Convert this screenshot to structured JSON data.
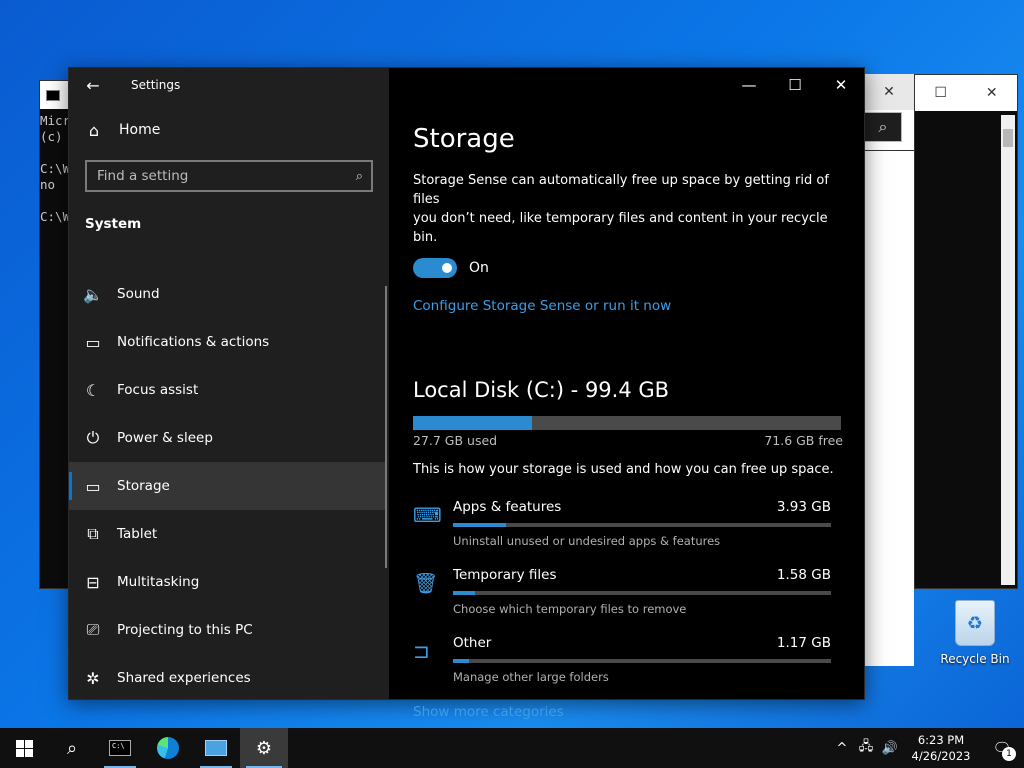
{
  "background_windows": {
    "cmd_text_lines": [
      "Micr",
      "(c)",
      "",
      "C:\\W",
      "no",
      "",
      "C:\\W"
    ],
    "explorer_search_icon": "search-icon",
    "cmd2_controls": [
      "—",
      "☐",
      "✕"
    ]
  },
  "settings": {
    "app_title": "Settings",
    "home_label": "Home",
    "search_placeholder": "Find a setting",
    "section_title": "System",
    "nav_items": [
      {
        "label": "Sound",
        "icon": "speaker-icon"
      },
      {
        "label": "Notifications & actions",
        "icon": "notification-icon"
      },
      {
        "label": "Focus assist",
        "icon": "moon-icon"
      },
      {
        "label": "Power & sleep",
        "icon": "power-icon"
      },
      {
        "label": "Storage",
        "icon": "storage-icon",
        "selected": true
      },
      {
        "label": "Tablet",
        "icon": "tablet-icon"
      },
      {
        "label": "Multitasking",
        "icon": "multitasking-icon"
      },
      {
        "label": "Projecting to this PC",
        "icon": "projector-icon"
      },
      {
        "label": "Shared experiences",
        "icon": "shared-experiences-icon"
      }
    ],
    "content": {
      "page_title": "Storage",
      "storage_sense_desc_line1": "Storage Sense can automatically free up space by getting rid of files",
      "storage_sense_desc_line2": "you don’t need, like temporary files and content in your recycle bin.",
      "toggle_label": "On",
      "configure_link": "Configure Storage Sense or run it now",
      "disk_title": "Local Disk (C:) - 99.4 GB",
      "disk_used_fraction": 0.279,
      "disk_used": "27.7 GB used",
      "disk_free": "71.6 GB free",
      "disk_note": "This is how your storage is used and how you can free up space.",
      "categories": [
        {
          "name": "Apps & features",
          "size": "3.93 GB",
          "desc": "Uninstall unused or undesired apps & features",
          "fraction": 0.14,
          "icon": "keyboard-icon"
        },
        {
          "name": "Temporary files",
          "size": "1.58 GB",
          "desc": "Choose which temporary files to remove",
          "fraction": 0.057,
          "icon": "trash-icon"
        },
        {
          "name": "Other",
          "size": "1.17 GB",
          "desc": "Manage other large folders",
          "fraction": 0.042,
          "icon": "folder-icon"
        }
      ],
      "more_link": "Show more categories"
    }
  },
  "desktop": {
    "recycle_bin_label": "Recycle Bin"
  },
  "taskbar": {
    "time": "6:23 PM",
    "date": "4/26/2023",
    "notification_count": "1"
  },
  "colors": {
    "accent": "#2b8bd1",
    "link": "#3b9de6",
    "sidebar_bg": "#1f1f1f",
    "content_bg": "#000000"
  }
}
